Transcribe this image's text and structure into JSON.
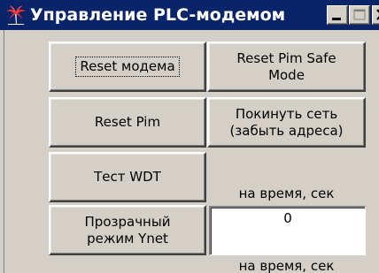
{
  "window": {
    "title": "Управление PLC-модемом"
  },
  "buttons": {
    "reset_modem": "Reset модема",
    "reset_pim_safe_mode": "Reset Pim Safe\nMode",
    "reset_pim": "Reset Pim",
    "leave_network": "Покинуть сеть\n(забыть адреса)",
    "test_wdt": "Тест WDT",
    "transparent_mode": "Прозрачный\nрежим Ynet"
  },
  "labels": {
    "time_sec_1": "на время, сек",
    "time_sec_2": "на время, сек"
  },
  "fields": {
    "time_value": "0"
  },
  "icons": {
    "app": "palm-tree-icon",
    "minimize": "minimize-icon",
    "maximize": "maximize-icon",
    "close": "close-icon"
  },
  "colors": {
    "titlebar": "#0a246a",
    "face": "#d4d0c8",
    "icon": "#e02020"
  }
}
